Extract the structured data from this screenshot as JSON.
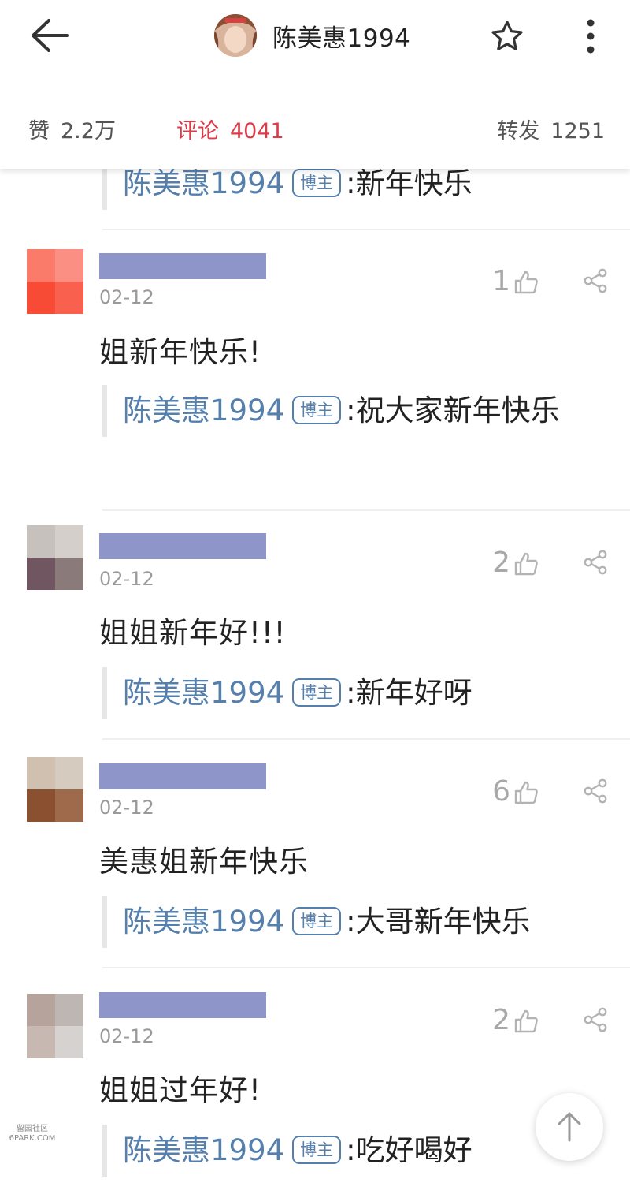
{
  "header": {
    "title": "陈美惠1994",
    "icons": {
      "back": "back-arrow-icon",
      "star": "star-icon",
      "more": "more-vertical-icon"
    }
  },
  "stats": {
    "likes_label": "赞",
    "likes_value": "2.2万",
    "comments_label": "评论",
    "comments_value": "4041",
    "reposts_label": "转发",
    "reposts_value": "1251"
  },
  "top_reply": {
    "author": "陈美惠1994",
    "badge": "博主",
    "text": ":新年快乐"
  },
  "comments": [
    {
      "date": "02-12",
      "likes": "1",
      "text": "姐新年快乐!",
      "reply": {
        "author": "陈美惠1994",
        "badge": "博主",
        "text": ":祝大家新年快乐"
      },
      "avatar_colors": [
        "#fb7b6b",
        "#fb8f84",
        "#f84b36",
        "#f9604e"
      ]
    },
    {
      "date": "02-12",
      "likes": "2",
      "text": "姐姐新年好!!!",
      "reply": {
        "author": "陈美惠1994",
        "badge": "博主",
        "text": ":新年好呀"
      },
      "avatar_colors": [
        "#c7c1be",
        "#d4cfcb",
        "#6f5660",
        "#8a7a7a"
      ]
    },
    {
      "date": "02-12",
      "likes": "6",
      "text": "美惠姐新年快乐",
      "reply": {
        "author": "陈美惠1994",
        "badge": "博主",
        "text": ":大哥新年快乐"
      },
      "avatar_colors": [
        "#cfc0b0",
        "#d5cbbf",
        "#8b5030",
        "#9f6a4c"
      ]
    },
    {
      "date": "02-12",
      "likes": "2",
      "text": "姐姐过年好!",
      "reply": {
        "author": "陈美惠1994",
        "badge": "博主",
        "text": ":吃好喝好"
      },
      "avatar_colors": [
        "#b6a49c",
        "#bdb6b2",
        "#c7b8b2",
        "#d6d2cf"
      ]
    }
  ],
  "colors": {
    "accent_red": "#e03a48",
    "link_blue": "#557fac",
    "name_bar": "#8e96c9"
  },
  "watermark": {
    "line1": "留园社区",
    "line2": "6PARK.COM"
  },
  "to_top_icon": "arrow-up-icon"
}
